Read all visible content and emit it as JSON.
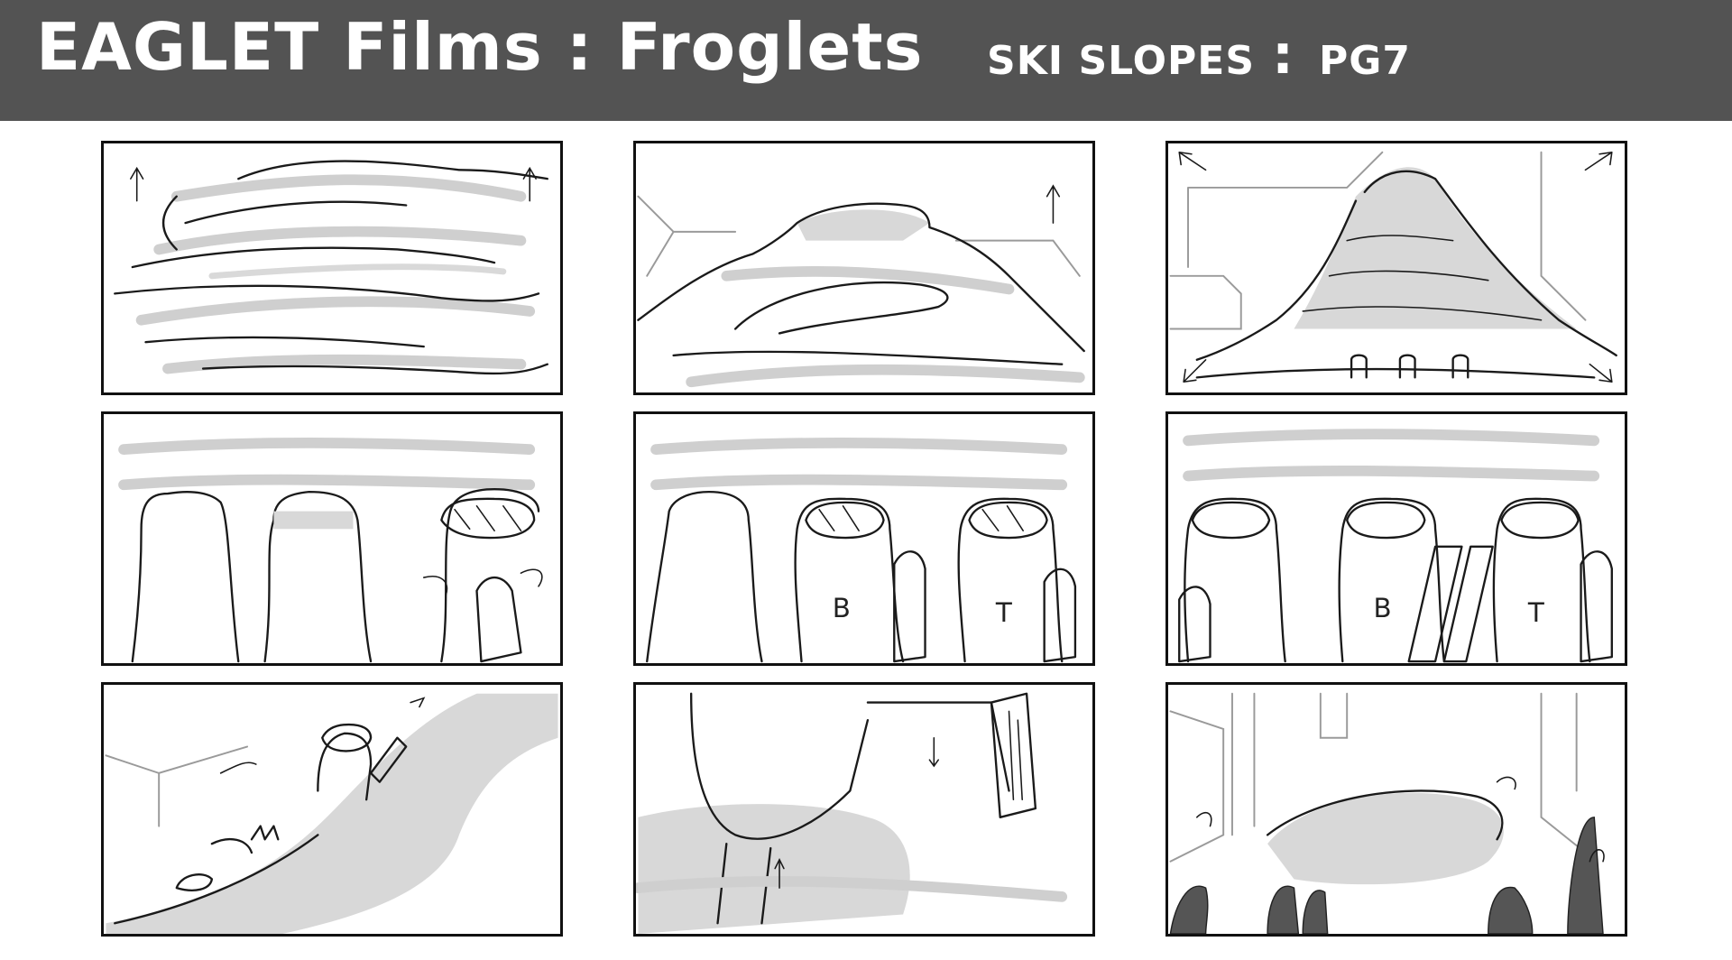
{
  "header": {
    "title": "EAGLET Films : Froglets",
    "scene": "SKI SLOPES",
    "separator": ":",
    "page": "PG7"
  },
  "colors": {
    "header_bg": "#535353",
    "header_text": "#ffffff",
    "panel_border": "#111111",
    "sketch_gray": "#cfcfcf"
  },
  "panels": {
    "p1": {
      "letters": []
    },
    "p2": {
      "letters": []
    },
    "p3": {
      "letters": []
    },
    "p4": {
      "letters": []
    },
    "p5": {
      "letters": [
        "B",
        "T"
      ]
    },
    "p6": {
      "letters": [
        "B",
        "T"
      ]
    },
    "p7": {
      "letters": []
    },
    "p8": {
      "letters": []
    },
    "p9": {
      "letters": []
    }
  }
}
